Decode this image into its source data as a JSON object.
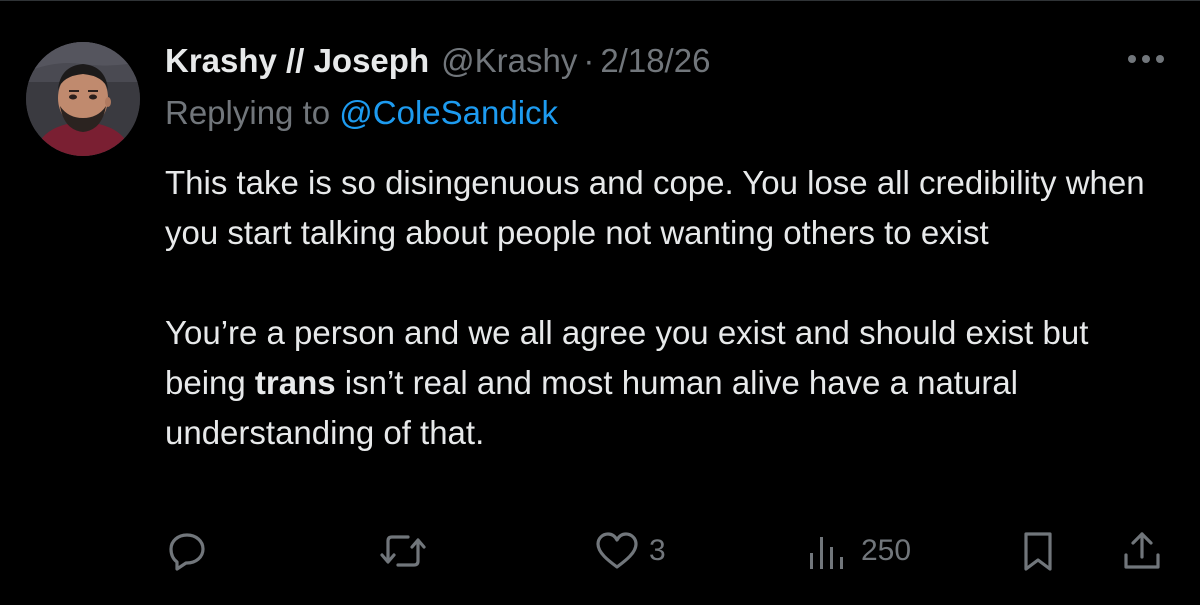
{
  "tweet": {
    "display_name": "Krashy // Joseph",
    "handle": "@Krashy",
    "separator": "·",
    "date": "2/18/26",
    "replying_prefix": "Replying to",
    "replying_to": "@ColeSandick",
    "body": {
      "paragraph1": "This take is so disingenuous and cope. You lose all credibility when you start talking about people not wanting others to exist",
      "paragraph2_before": "You’re a person and we all agree you exist and should exist but being ",
      "paragraph2_bold": "trans",
      "paragraph2_after": " isn’t real and most human alive have a natural understanding of that."
    }
  },
  "actions": {
    "reply_icon": "reply-icon",
    "retweet_icon": "retweet-icon",
    "like_icon": "heart-icon",
    "like_count": "3",
    "views_icon": "views-chart-icon",
    "view_count": "250",
    "bookmark_icon": "bookmark-icon",
    "share_icon": "share-icon",
    "more_icon": "more-dots-icon"
  },
  "colors": {
    "background": "#000000",
    "text_primary": "#e7e9ea",
    "text_secondary": "#71767b",
    "link": "#1d9bf0"
  }
}
